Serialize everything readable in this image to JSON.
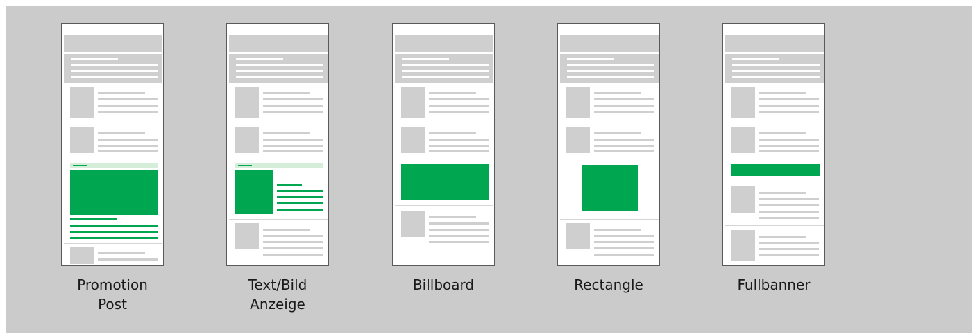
{
  "captions": [
    {
      "line1": "Promotion",
      "line2": "Post"
    },
    {
      "line1": "Text/Bild",
      "line2": "Anzeige"
    },
    {
      "line1": "Billboard",
      "line2": ""
    },
    {
      "line1": "Rectangle",
      "line2": ""
    },
    {
      "line1": "Fullbanner",
      "line2": ""
    }
  ],
  "colors": {
    "background": "#cbcbcb",
    "placeholder_gray": "#cfcfcf",
    "ad_green": "#00a650",
    "ad_light_green": "#d5eed9"
  }
}
